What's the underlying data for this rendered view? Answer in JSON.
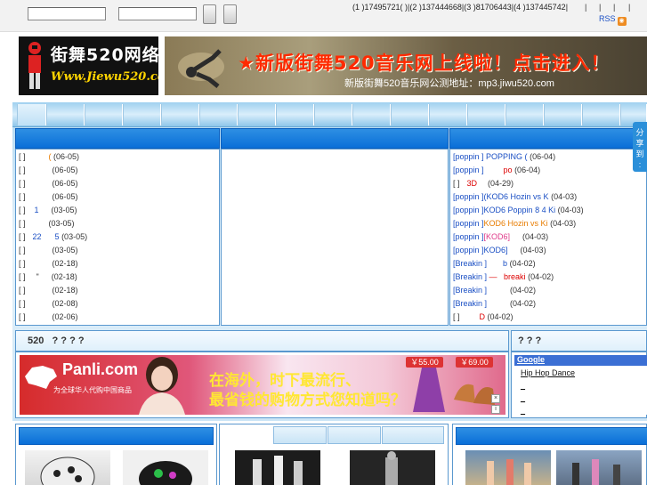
{
  "topbar": {
    "qq_groups": "(1 )17495721( )|(2 )137444668|(3 )81706443|(4 )137445742|",
    "pipes": [
      "|",
      "|",
      "|",
      "|"
    ],
    "rss_label": "RSS"
  },
  "logo": {
    "line1": "街舞520网络",
    "line2": "Www.Jiewu520.coM"
  },
  "banner": {
    "headline": "★新版街舞520音乐网上线啦！点击进入！",
    "subline": "新版街舞520音乐网公测地址：mp3.jiwu520.com"
  },
  "left_list": [
    {
      "tag": "[  ]",
      "mid": "(",
      "date": "(06-05)"
    },
    {
      "tag": "[  ]",
      "mid": "",
      "date": "(06-05)"
    },
    {
      "tag": "[  ]",
      "mid": "",
      "date": "(06-05)"
    },
    {
      "tag": "[  ]",
      "mid": "",
      "date": "(06-05)"
    },
    {
      "tag": "[  ]",
      "mid": "1",
      "date": "(03-05)"
    },
    {
      "tag": "[  ]",
      "mid": "",
      "date": "(03-05)"
    },
    {
      "tag": "[  ]",
      "mid": "22      5",
      "date": "(03-05)"
    },
    {
      "tag": "[  ]",
      "mid": "",
      "date": "(03-05)"
    },
    {
      "tag": "[  ]",
      "mid": "",
      "date": "(02-18)"
    },
    {
      "tag": "[  ]",
      "mid": "\"",
      "date": "(02-18)"
    },
    {
      "tag": "[  ]",
      "mid": "",
      "date": "(02-18)"
    },
    {
      "tag": "[  ]",
      "mid": "",
      "date": "(02-08)"
    },
    {
      "tag": "[  ]",
      "mid": "",
      "date": "(02-06)"
    }
  ],
  "right_list": [
    {
      "tag": "[poppin  ]",
      "title": "POPPING  (",
      "date": "(06-04)"
    },
    {
      "tag": "[poppin  ]",
      "title": "po",
      "date": "(06-04)"
    },
    {
      "tag": "[  ]",
      "title": "3D",
      "date": "(04-29)"
    },
    {
      "tag": "[poppin  ]",
      "title": "(KOD6 Hozin vs K",
      "date": "(04-03)"
    },
    {
      "tag": "[poppin  ]",
      "title": "KOD6 Poppin 8 4 Ki",
      "date": "(04-03)"
    },
    {
      "tag": "[poppin  ]",
      "title": "KOD6   Hozin vs Ki",
      "date": "(04-03)"
    },
    {
      "tag": "[poppin  ]",
      "title": "[KOD6]",
      "date": "(04-03)"
    },
    {
      "tag": "[poppin  ]",
      "title": "KOD6]",
      "date": "(04-03)"
    },
    {
      "tag": "[Breakin  ]",
      "title": "b",
      "date": "(04-02)"
    },
    {
      "tag": "[Breakin  ]",
      "title": "—   breaki",
      "date": "(04-02)"
    },
    {
      "tag": "[Breakin  ]",
      "title": "",
      "date": "(04-02)"
    },
    {
      "tag": "[Breakin  ]",
      "title": "",
      "date": "(04-02)"
    },
    {
      "tag": "[  ]",
      "title": "D",
      "date": "(04-02)"
    }
  ],
  "section2": {
    "left_title": "520   ? ? ? ?",
    "right_title": "? ? ?"
  },
  "ad": {
    "brand": "Panli.com",
    "brand_sub": "为全球华人代购中国商品",
    "line1": "在海外，时下最流行、",
    "line2": "最省钱的购物方式您知道吗？",
    "price1": "￥55.00",
    "price2": "￥69.00"
  },
  "share": {
    "label": "分\n享\n到\n:"
  },
  "right_search": {
    "google": "Google",
    "links": [
      "Hip Hop Dance",
      "_",
      "_",
      "_"
    ]
  },
  "colors": {
    "header_blue": "#0a6fd8",
    "link_blue": "#1a4fc4",
    "accent_red": "#d00"
  }
}
